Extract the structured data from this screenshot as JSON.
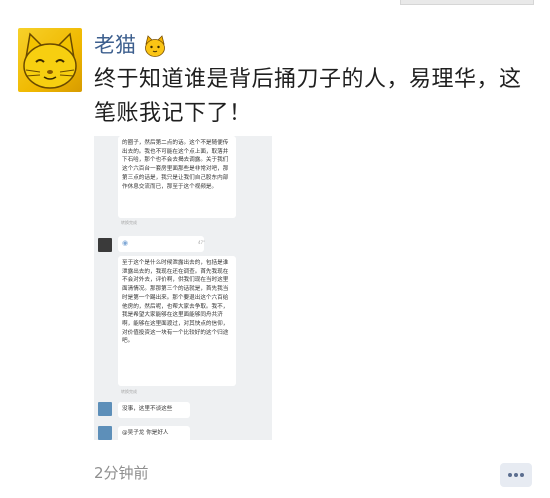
{
  "post": {
    "author": "老猫",
    "author_emoji": "cat-face-icon",
    "text": "终于知道谁是背后捅刀子的人，易理华，这笔账我记下了！",
    "time": "2分钟前",
    "comment_icon": "more-dots-icon"
  },
  "screenshot": {
    "bubble1": "的圈子，然后第二点的话。这个不是随便传出去的。我也不可能在这个点上面，取落井下石哈，那个也不会去揭去调露。关于我们这个六百台一套房里面那些是非常对吧，那第三点的话是，我只是让我们自己股东内部作休息交流而已，那至于这个视频是。",
    "bubble1_meta": "转换完成",
    "voice_duration": "47\"",
    "bubble3": "至于这个是什么时候泄露出去的，包括是谁泄露出去的，我现在还在调查。首先我现在不会对外去，评价啊，供我们现在当时这里面清情况。那那第三个的话就是，首先我当时是第一个踢出来。那个要退出这个六百给他房的，然后呢，也帮大家去争取。我不，我是希望大家能够在这里面能够同舟共济啊，能够在这里面渡过，对其快点的信仰，对价值投资这一块有一个比较好的这个归途吧。",
    "bubble3_meta": "转换完成",
    "bubble4": "没事，这里不谈这些",
    "bubble5": "@吴子龙  你是好人"
  },
  "colors": {
    "nickname": "#3d5f8e",
    "text": "#1f1f1f",
    "time": "#8f8f8f"
  }
}
